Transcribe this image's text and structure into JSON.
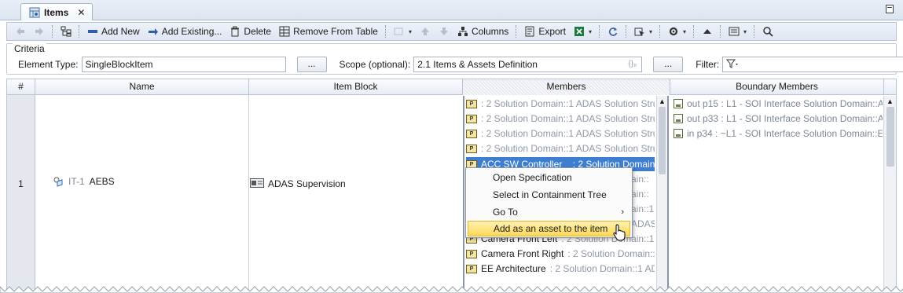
{
  "tab": {
    "label": "Items",
    "close": "✕"
  },
  "toolbar": {
    "add_new": "Add New",
    "add_existing": "Add Existing...",
    "delete": "Delete",
    "remove_from_table": "Remove From Table",
    "columns": "Columns",
    "export": "Export"
  },
  "criteria": {
    "legend": "Criteria",
    "element_type_label": "Element Type:",
    "element_type_value": "SingleBlockItem",
    "dots": "...",
    "scope_label": "Scope (optional):",
    "scope_value": "2.1 Items & Assets Definition",
    "scope_badge": "{}₈",
    "filter_label": "Filter:"
  },
  "table": {
    "headers": {
      "num": "#",
      "name": "Name",
      "item_block": "Item Block",
      "members": "Members",
      "boundary": "Boundary Members"
    },
    "row": {
      "num": "1",
      "id": "IT-1",
      "name": "AEBS",
      "item_block": "ADAS Supervision"
    },
    "members": [
      {
        "name": "",
        "rest": ": 2 Solution Domain::1 ADAS Solution Stru"
      },
      {
        "name": "",
        "rest": ": 2 Solution Domain::1 ADAS Solution Stru"
      },
      {
        "name": "",
        "rest": ": 2 Solution Domain::1 ADAS Solution Stru"
      },
      {
        "name": "",
        "rest": ": 2 Solution Domain::1 ADAS Solution Stru"
      },
      {
        "name": "ACC SW Controller",
        "rest": ": 2 Solution Domain::1"
      },
      {
        "name": "",
        "rest": "ain::"
      },
      {
        "name": "",
        "rest": "ain::"
      },
      {
        "name": "",
        "rest": "ain::1"
      },
      {
        "name": "",
        "rest": "ADAS"
      },
      {
        "name": "Camera Front Left",
        "rest": ": 2 Solution Domain::1 A"
      },
      {
        "name": "Camera Front Right",
        "rest": ": 2 Solution Domain::1"
      },
      {
        "name": "EE Architecture",
        "rest": ": 2 Solution Domain::1 AD"
      }
    ],
    "boundary": [
      "out p15 : L1 - SOI Interface Solution Domain::AI",
      "out p33 : L1 - SOI Interface Solution Domain::AI",
      "in p34 : ~L1 - SOI Interface Solution Domain::El"
    ]
  },
  "context_menu": {
    "items": [
      "Open Specification",
      "Select in Containment Tree",
      "Go To",
      "Add as an asset to the item"
    ],
    "submenu_arrow": "›"
  },
  "colors": {
    "selection": "#3d7ed1",
    "hover": "#fcd85a",
    "header_bg": "#e8edf5"
  }
}
